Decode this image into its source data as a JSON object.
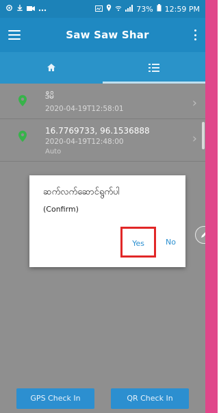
{
  "status_bar": {
    "battery_percent": "73%",
    "time": "12:59 PM"
  },
  "toolbar": {
    "title": "Saw Saw Shar"
  },
  "tabs": [
    {
      "icon": "home-icon"
    },
    {
      "icon": "list-icon"
    }
  ],
  "list": [
    {
      "title": "ဒီမိ",
      "timestamp": "2020-04-19T12:58:01",
      "note": ""
    },
    {
      "title": "16.7769733, 96.1536888",
      "timestamp": "2020-04-19T12:48:00",
      "note": "Auto"
    }
  ],
  "dialog": {
    "title": "ဆက်လက်ဆောင်ရွက်ပါ",
    "subtitle": "(Confirm)",
    "yes_label": "Yes",
    "no_label": "No"
  },
  "bottom_buttons": {
    "gps_label": "GPS Check In",
    "qr_label": "QR Check In"
  },
  "colors": {
    "toolbar": "#1f89c2",
    "tabs": "#2a93c9",
    "button": "#2c8fd0",
    "highlight": "#e12727",
    "pin": "#37b34a",
    "right_border": "#e0478a"
  }
}
